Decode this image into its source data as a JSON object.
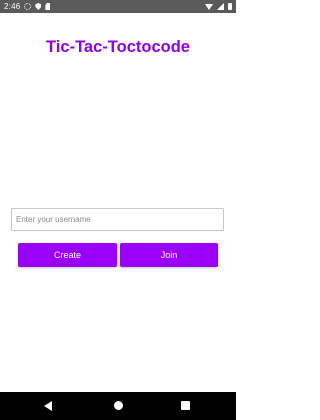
{
  "status_bar": {
    "time": "2:46",
    "left_icons": [
      "gear-icon",
      "shield-icon",
      "sd-card-icon"
    ],
    "right_icons": [
      "wifi-icon",
      "signal-icon",
      "battery-icon"
    ]
  },
  "app": {
    "title": "Tic-Tac-Toctocode",
    "accent_color": "#9400e6"
  },
  "username": {
    "placeholder": "Enter your username",
    "value": ""
  },
  "actions": {
    "create_label": "Create",
    "join_label": "Join"
  },
  "nav_bar": {
    "icons": [
      "back-icon",
      "home-icon",
      "recents-icon"
    ]
  }
}
